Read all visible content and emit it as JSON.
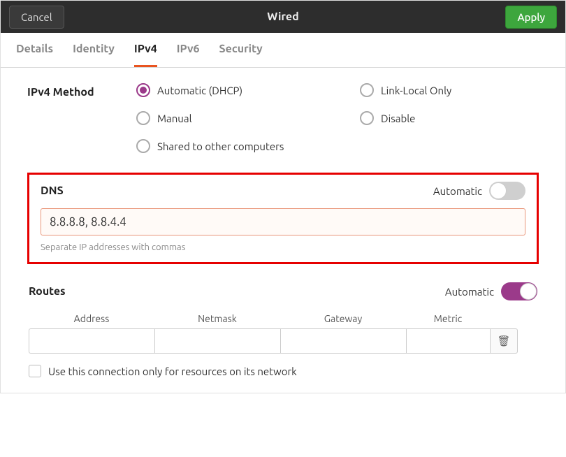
{
  "titlebar": {
    "cancel": "Cancel",
    "title": "Wired",
    "apply": "Apply"
  },
  "tabs": {
    "items": [
      {
        "id": "details",
        "label": "Details",
        "active": false
      },
      {
        "id": "identity",
        "label": "Identity",
        "active": false
      },
      {
        "id": "ipv4",
        "label": "IPv4",
        "active": true
      },
      {
        "id": "ipv6",
        "label": "IPv6",
        "active": false
      },
      {
        "id": "security",
        "label": "Security",
        "active": false
      }
    ]
  },
  "method": {
    "label": "IPv4 Method",
    "options": [
      {
        "id": "auto",
        "label": "Automatic (DHCP)",
        "selected": true
      },
      {
        "id": "linklocal",
        "label": "Link-Local Only",
        "selected": false
      },
      {
        "id": "manual",
        "label": "Manual",
        "selected": false
      },
      {
        "id": "disable",
        "label": "Disable",
        "selected": false
      },
      {
        "id": "shared",
        "label": "Shared to other computers",
        "selected": false
      }
    ]
  },
  "dns": {
    "title": "DNS",
    "automatic_label": "Automatic",
    "automatic_on": false,
    "value": "8.8.8.8, 8.8.4.4",
    "hint": "Separate IP addresses with commas"
  },
  "routes": {
    "title": "Routes",
    "automatic_label": "Automatic",
    "automatic_on": true,
    "columns": {
      "address": "Address",
      "netmask": "Netmask",
      "gateway": "Gateway",
      "metric": "Metric"
    },
    "rows": [
      {
        "address": "",
        "netmask": "",
        "gateway": "",
        "metric": ""
      }
    ],
    "only_resources_label": "Use this connection only for resources on its network",
    "only_resources_checked": false
  }
}
